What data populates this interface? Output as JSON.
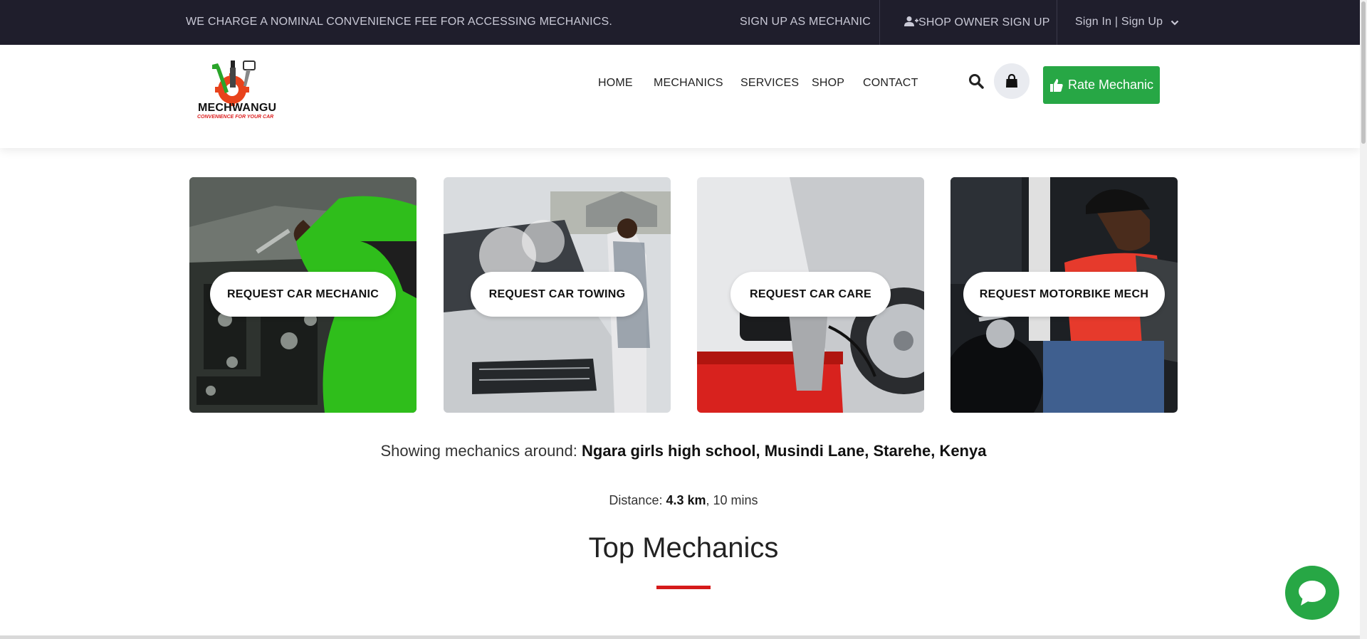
{
  "topbar": {
    "notice": "WE CHARGE A NOMINAL CONVENIENCE FEE FOR ACCESSING MECHANICS.",
    "signup_mechanic": "SIGN UP AS MECHANIC",
    "shop_owner_signup": "SHOP OWNER SIGN UP",
    "signin_signup": "Sign In | Sign Up",
    "bg_color": "#1f1e2c"
  },
  "header": {
    "brand": "MECHWANGU",
    "tagline": "CONVENIENCE FOR YOUR CAR",
    "nav": [
      "HOME",
      "MECHANICS",
      "SERVICES",
      "SHOP",
      "CONTACT"
    ],
    "rate_button": "Rate Mechanic",
    "accent_color": "#27a745"
  },
  "cards": [
    {
      "label": "REQUEST CAR MECHANIC",
      "image": "mechanic-working-on-engine"
    },
    {
      "label": "REQUEST CAR TOWING",
      "image": "smoking-car-breakdown"
    },
    {
      "label": "REQUEST CAR CARE",
      "image": "car-polishing"
    },
    {
      "label": "REQUEST MOTORBIKE MECH",
      "image": "motorbike-rider-on-phone"
    }
  ],
  "location": {
    "prefix": "Showing mechanics around:",
    "place": "Ngara girls high school, Musindi Lane, Starehe, Kenya"
  },
  "distance": {
    "prefix": "Distance:",
    "km": "4.3 km",
    "time": ", 10 mins"
  },
  "section": {
    "title": "Top Mechanics",
    "underline_color": "#d51a1a"
  },
  "icons": {
    "search": "search-icon",
    "bag": "shopping-bag-icon",
    "thumbs_up": "thumbs-up-icon",
    "chat": "chat-bubble-icon",
    "user_plus": "user-plus-icon",
    "chevron": "chevron-down-icon"
  }
}
